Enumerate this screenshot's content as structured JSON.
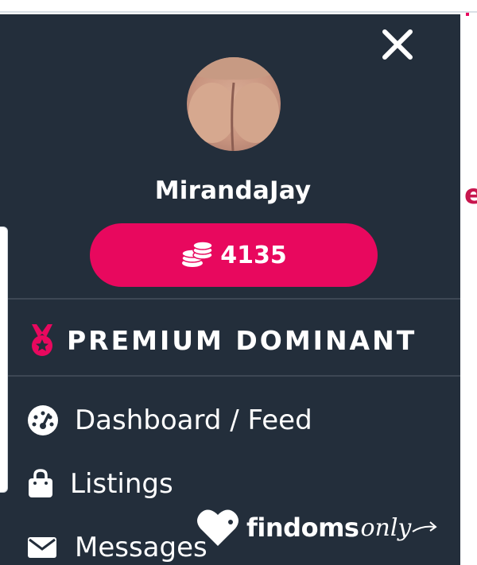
{
  "profile": {
    "username": "MirandaJay",
    "token_balance": "4135"
  },
  "rank": {
    "label": "PREMIUM DOMINANT",
    "icon": "medal-icon"
  },
  "menu": {
    "items": [
      {
        "label": "Dashboard / Feed",
        "icon": "dashboard-gauge-icon"
      },
      {
        "label": "Listings",
        "icon": "shopping-bag-icon"
      },
      {
        "label": "Messages",
        "icon": "envelope-icon"
      }
    ]
  },
  "watermark": {
    "brand": "findoms",
    "script": "only"
  },
  "colors": {
    "drawer_bg": "#232e3b",
    "accent": "#e8085e",
    "text": "#ffffff",
    "divider": "#3d4754"
  }
}
